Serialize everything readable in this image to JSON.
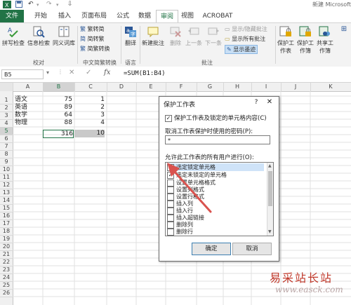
{
  "titlebar": {
    "app_title": "新建 Microsoft"
  },
  "tabs": [
    "文件",
    "开始",
    "插入",
    "页面布局",
    "公式",
    "数据",
    "审阅",
    "视图",
    "ACROBAT"
  ],
  "ribbon": {
    "proofing": {
      "spell": "拼写检查",
      "research": "信息检索",
      "thesaurus": "同义词库",
      "group": "校对"
    },
    "chinese": {
      "to_trad": "繁转简",
      "to_simp": "简转繁",
      "convert": "简繁转换",
      "group": "中文简繁转换"
    },
    "language": {
      "translate": "翻译",
      "group": "语言"
    },
    "comments": {
      "new": "新建批注",
      "delete": "删除",
      "prev": "上一条",
      "next": "下一条",
      "show_hide": "显示/隐藏批注",
      "show_all": "显示所有批注",
      "show_ink": "显示墨迹",
      "group": "批注"
    },
    "changes": {
      "protect_sheet": "保护工作表",
      "protect_book": "保护工作簿",
      "share_book": "共享工作簿"
    }
  },
  "formula_bar": {
    "name_box": "B5",
    "formula": "=SUM(B1:B4)"
  },
  "columns": [
    "A",
    "B",
    "C",
    "D",
    "E",
    "F",
    "G",
    "H",
    "I",
    "J",
    "K"
  ],
  "rows": [
    "1",
    "2",
    "3",
    "4",
    "5",
    "6",
    "7",
    "8",
    "9",
    "10",
    "11",
    "12",
    "13",
    "14",
    "15",
    "16",
    "17",
    "18",
    "19",
    "20",
    "21",
    "22",
    "23",
    "24",
    "25",
    "26"
  ],
  "cells": {
    "A": [
      "语文",
      "英语",
      "数学",
      "物理",
      ""
    ],
    "B": [
      "75",
      "89",
      "64",
      "88",
      "316"
    ],
    "C": [
      "1",
      "2",
      "3",
      "4",
      "10"
    ]
  },
  "dialog": {
    "title": "保护工作表",
    "help": "?",
    "close": "✕",
    "protect_check_label": "保护工作表及锁定的单元格内容(C)",
    "protect_checked": true,
    "password_label": "取消工作表保护时使用的密码(P):",
    "password_value": "*",
    "allow_label": "允许此工作表的所有用户进行(O):",
    "permissions": [
      {
        "label": "选定锁定单元格",
        "checked": true
      },
      {
        "label": "选定未锁定的单元格",
        "checked": true
      },
      {
        "label": "设置单元格格式",
        "checked": false
      },
      {
        "label": "设置列格式",
        "checked": false
      },
      {
        "label": "设置行格式",
        "checked": false
      },
      {
        "label": "插入列",
        "checked": false
      },
      {
        "label": "插入行",
        "checked": false
      },
      {
        "label": "插入超链接",
        "checked": false
      },
      {
        "label": "删除列",
        "checked": false
      },
      {
        "label": "删除行",
        "checked": false
      }
    ],
    "ok": "确定",
    "cancel": "取消"
  },
  "watermark": {
    "line1": "易采站长站",
    "line2": "www.easck.com"
  },
  "colors": {
    "accent": "#217346",
    "arrow": "#d9534f"
  }
}
